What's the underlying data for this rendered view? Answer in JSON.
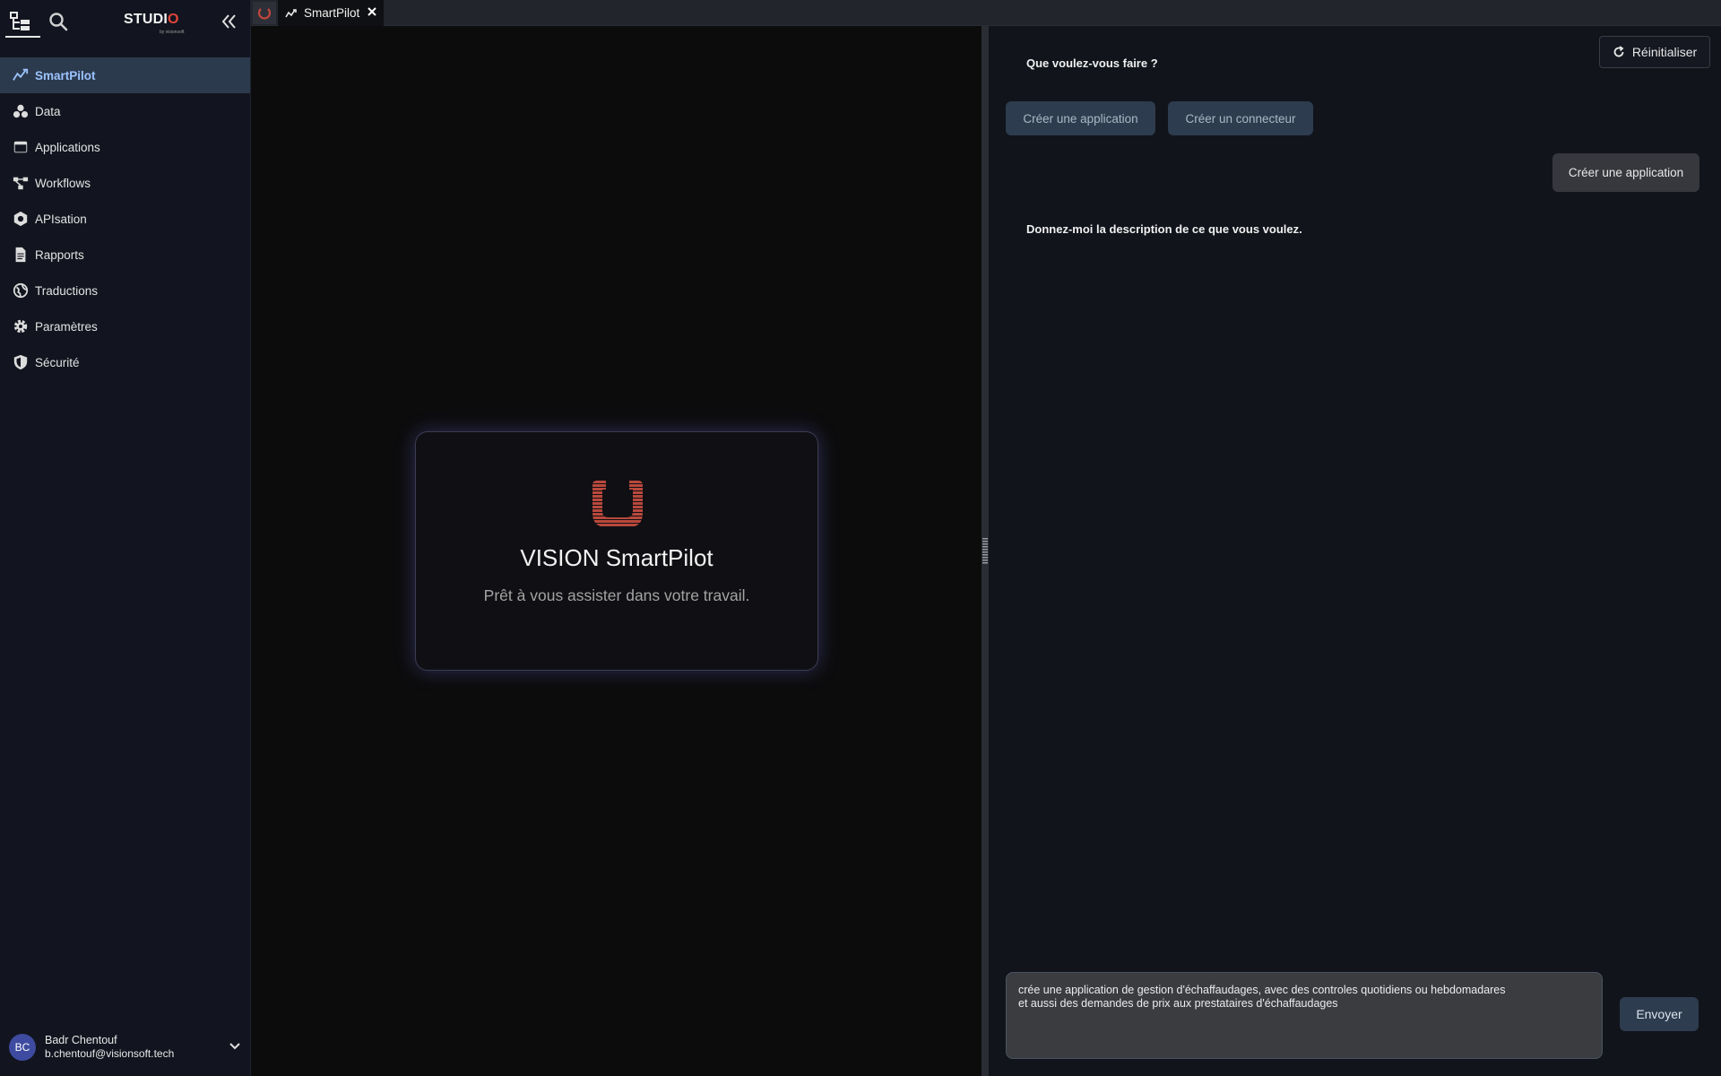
{
  "sidebar": {
    "logo_text": "STUDI",
    "logo_accent": "O",
    "logo_sub": "by visionsoft",
    "items": [
      {
        "label": "SmartPilot",
        "icon": "smartpilot-icon",
        "active": true
      },
      {
        "label": "Data",
        "icon": "data-icon"
      },
      {
        "label": "Applications",
        "icon": "applications-icon"
      },
      {
        "label": "Workflows",
        "icon": "workflows-icon"
      },
      {
        "label": "APIsation",
        "icon": "apisation-icon"
      },
      {
        "label": "Rapports",
        "icon": "report-icon"
      },
      {
        "label": "Traductions",
        "icon": "globe-icon"
      },
      {
        "label": "Paramètres",
        "icon": "gear-icon"
      },
      {
        "label": "Sécurité",
        "icon": "shield-icon"
      }
    ],
    "user": {
      "initials": "BC",
      "name": "Badr Chentouf",
      "email": "b.chentouf@visionsoft.tech"
    }
  },
  "tabs": [
    {
      "label": "SmartPilot",
      "icon": "smartpilot-icon",
      "active": true
    }
  ],
  "preview": {
    "title": "VISION SmartPilot",
    "subtitle": "Prêt à vous assister dans votre travail."
  },
  "chat": {
    "reset_label": "Réinitialiser",
    "question1": "Que voulez-vous faire ?",
    "options": [
      "Créer une application",
      "Créer un connecteur"
    ],
    "user_reply": "Créer une application",
    "question2": "Donnez-moi la description de ce que vous voulez.",
    "input_value": "crée une application de gestion d'échaffaudages, avec des controles quotidiens ou hebdomadares\net aussi des demandes de prix aux prestataires d'échaffaudages",
    "send_label": "Envoyer"
  },
  "colors": {
    "accent_red": "#e0453a",
    "active_nav_bg": "#2c3a4d",
    "active_nav_text": "#9cc4ff",
    "button_bg": "#2d3c4e"
  }
}
